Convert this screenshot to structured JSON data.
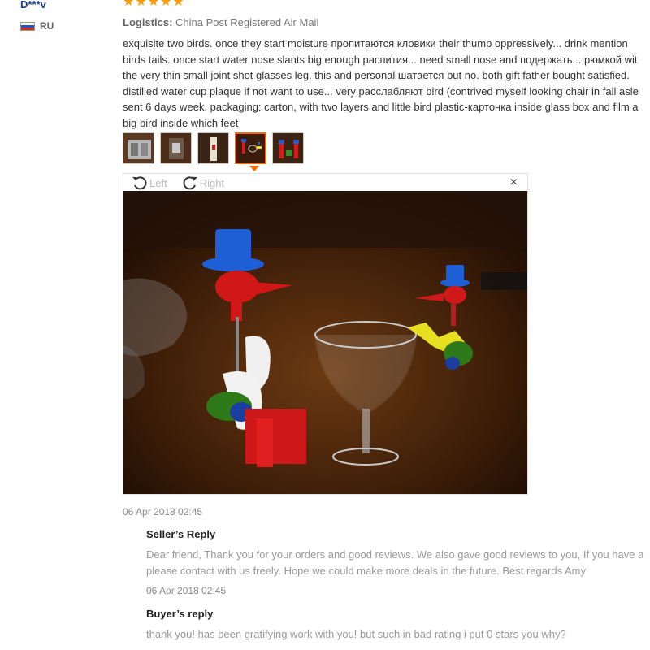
{
  "review": {
    "user_name": "D***v",
    "country_code": "RU",
    "rating_stars": 5,
    "logistics_label": "Logistics:",
    "logistics_value": "China Post Registered Air Mail",
    "text_lines": [
      "exquisite two birds. once they start moisture пропитаются кловики their thump oppressively... drink mention",
      "birds tails. once start water nose slants big enough распития... need small nose and подержать... рюмкой wit",
      "the very thin small joint shot glasses leg. this and personal шатается but no. both gift father bought satisfied.",
      "distilled water cup plaque if not want to use... very расслабляют bird (contrived myself looking chair in fall asle",
      "sent 6 days week. packaging: carton, with two layers and little bird plastic-картонка inside glass box and film a",
      "big bird inside which feet"
    ],
    "date": "06 Apr 2018 02:45"
  },
  "viewer": {
    "rotate_left_label": "Left",
    "rotate_right_label": "Right",
    "close_label": "×",
    "thumbnail_count": 5,
    "active_thumbnail": 4
  },
  "seller_reply": {
    "title": "Seller’s Reply",
    "text_lines": [
      "Dear friend, Thank you for your orders and good reviews. We also gave good reviews to you, If you have a",
      "please contact with us freely. Hope we could make more deals in the future. Best regards Amy"
    ],
    "date": "06 Apr 2018 02:45"
  },
  "buyer_reply": {
    "title": "Buyer’s reply",
    "text_lines": [
      "thank you! has been gratifying work with you! but such in bad rating i put 0 stars you why?"
    ]
  },
  "colors": {
    "star": "#ff9a00",
    "accent": "#ff6a00",
    "username": "#1a3d8f"
  },
  "icons": [
    "star-icon",
    "russia-flag-icon",
    "rotate-left-icon",
    "rotate-right-icon",
    "close-icon"
  ]
}
